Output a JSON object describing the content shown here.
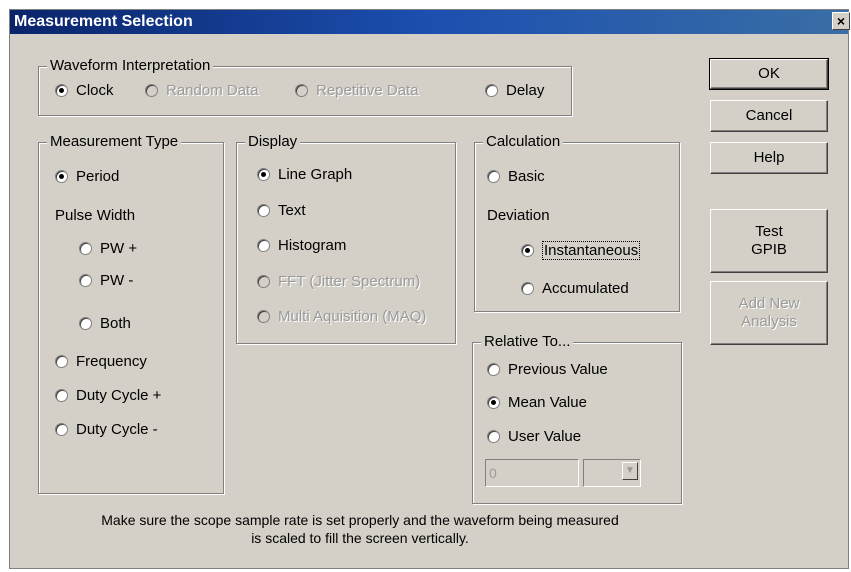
{
  "window": {
    "title": "Measurement Selection",
    "close_glyph": "×"
  },
  "waveform": {
    "legend": "Waveform Interpretation",
    "options": [
      {
        "label": "Clock",
        "selected": true,
        "enabled": true
      },
      {
        "label": "Random Data",
        "selected": false,
        "enabled": false
      },
      {
        "label": "Repetitive Data",
        "selected": false,
        "enabled": false
      },
      {
        "label": "Delay",
        "selected": false,
        "enabled": true
      }
    ]
  },
  "measurement": {
    "legend": "Measurement Type",
    "period": "Period",
    "pulse_width_label": "Pulse Width",
    "pw_plus": "PW +",
    "pw_minus": "PW -",
    "both": "Both",
    "frequency": "Frequency",
    "duty_plus": "Duty Cycle +",
    "duty_minus": "Duty Cycle -"
  },
  "display": {
    "legend": "Display",
    "line_graph": "Line Graph",
    "text": "Text",
    "histogram": "Histogram",
    "fft": "FFT (Jitter Spectrum)",
    "maq": "Multi Aquisition (MAQ)"
  },
  "calculation": {
    "legend": "Calculation",
    "basic": "Basic",
    "deviation_label": "Deviation",
    "instantaneous": "Instantaneous",
    "accumulated": "Accumulated"
  },
  "relative": {
    "legend": "Relative To...",
    "previous": "Previous Value",
    "mean": "Mean Value",
    "user": "User Value",
    "value_input": "0"
  },
  "buttons": {
    "ok": "OK",
    "cancel": "Cancel",
    "help": "Help",
    "test_gpib_1": "Test",
    "test_gpib_2": "GPIB",
    "add_new_1": "Add New",
    "add_new_2": "Analysis"
  },
  "footer": {
    "line1": "Make sure the scope sample rate is set properly and the waveform being measured",
    "line2": "is scaled to fill the screen vertically."
  }
}
